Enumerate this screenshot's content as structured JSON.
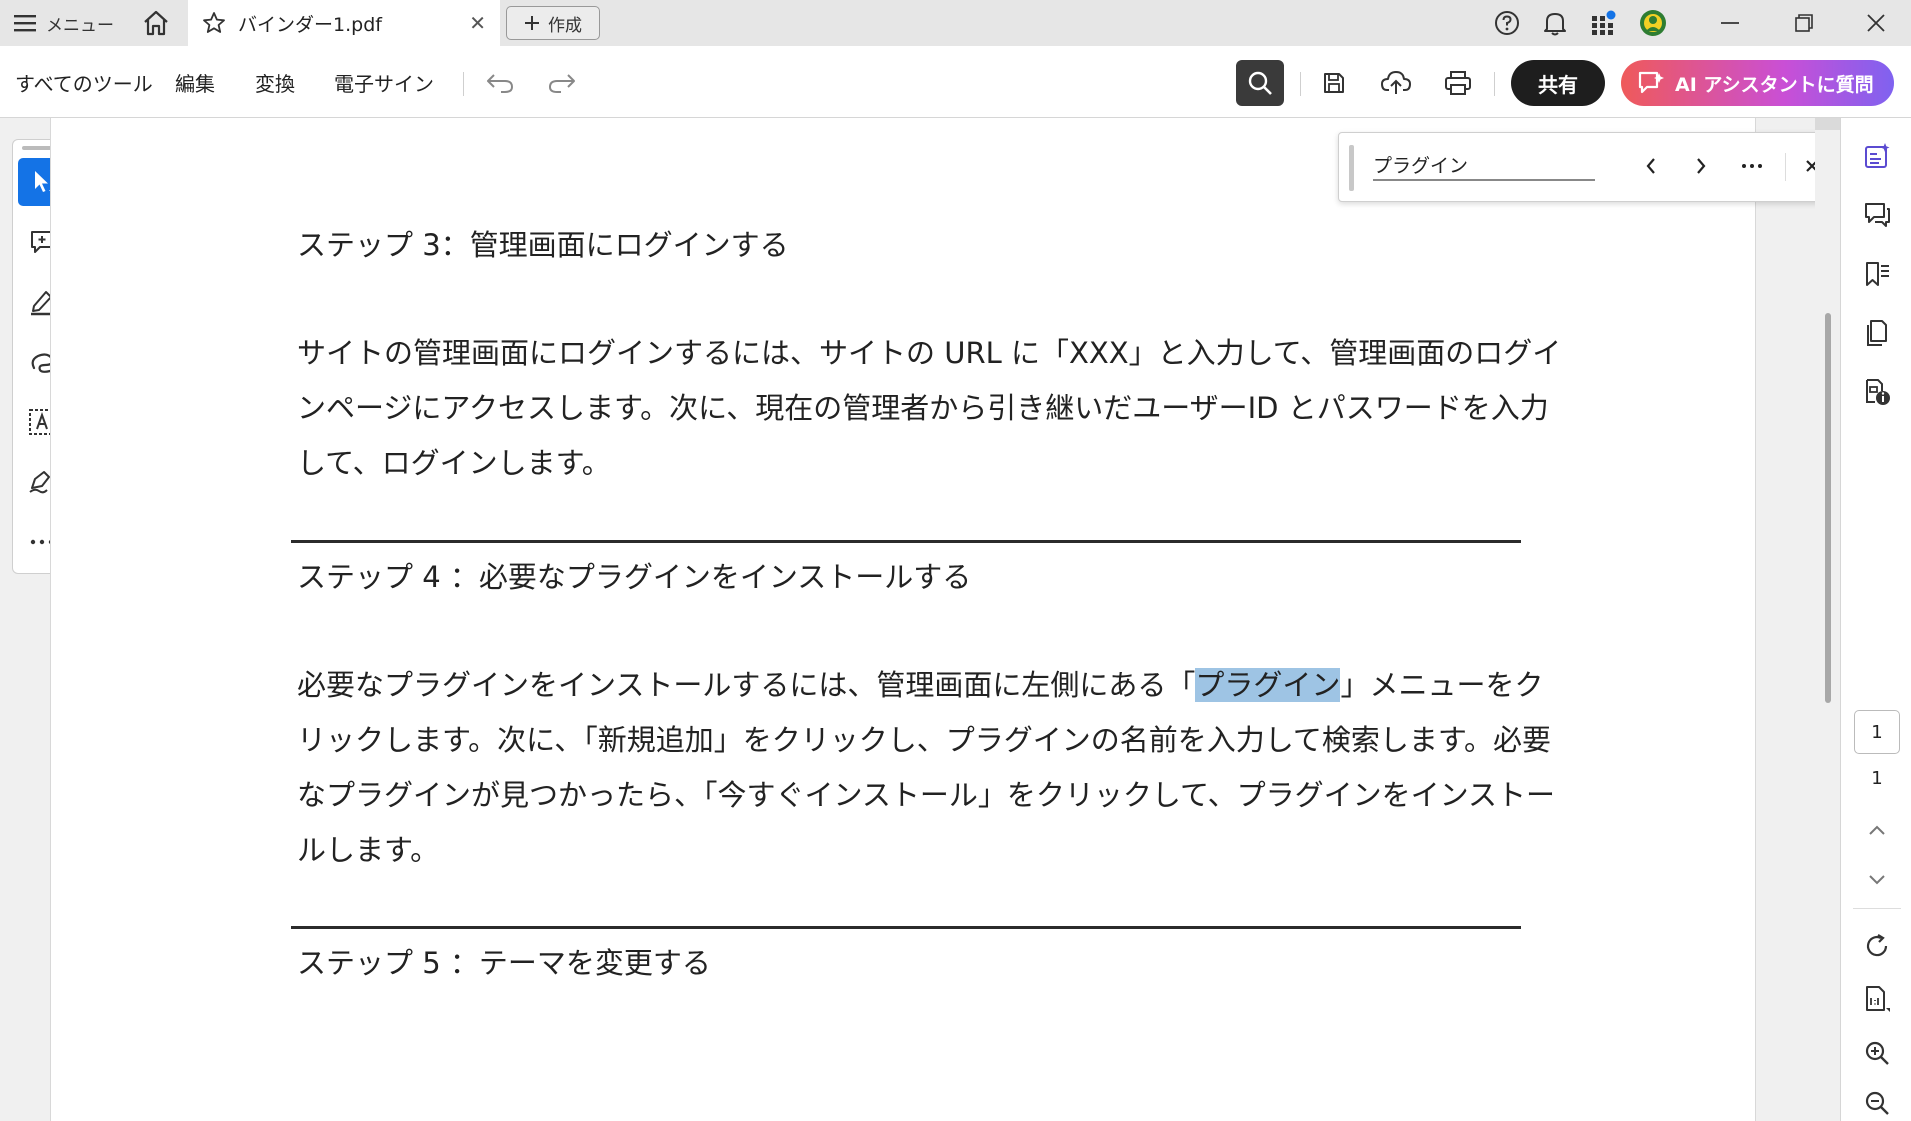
{
  "titlebar": {
    "menu_label": "メニュー",
    "tab_title": "バインダー1.pdf",
    "new_label": "作成"
  },
  "toolbar": {
    "all_tools": "すべてのツール",
    "edit": "編集",
    "convert": "変換",
    "esign": "電子サイン",
    "share": "共有",
    "ai_assistant": "AI アシスタントに質問"
  },
  "find": {
    "query": "プラグイン"
  },
  "document": {
    "step3_heading": "ステップ 3：管理画面にログインする",
    "step3_body": "サイトの管理画面にログインするには、サイトの URL に「XXX」と入力して、管理画面のログインページにアクセスします。次に、現在の管理者から引き継いだユーザーID とパスワードを入力して、ログインします。",
    "step4_heading": "ステップ 4 ：必要なプラグインをインストールする",
    "step4_body_before": "必要なプラグインをインストールするには、管理画面に左側にある「",
    "step4_body_highlight": "プラグイン",
    "step4_body_after": "」メニューをクリックします。次に、「新規追加」をクリックし、プラグインの名前を入力して検索します。必要なプラグインが見つかったら、「今すぐインストール」をクリックして、プラグインをインストールします。",
    "step5_heading": "ステップ 5 ：テーマを変更する"
  },
  "pagination": {
    "current": "1",
    "total": "1"
  },
  "colors": {
    "accent": "#1473e6",
    "highlight": "#9ec4e4"
  }
}
